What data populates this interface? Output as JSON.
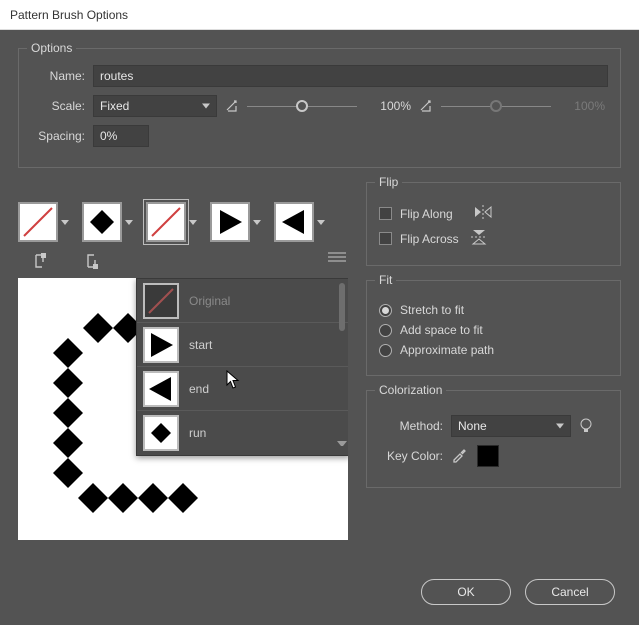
{
  "window": {
    "title": "Pattern Brush Options"
  },
  "options": {
    "title": "Options",
    "name_label": "Name:",
    "name_value": "routes",
    "scale_label": "Scale:",
    "scale_mode": "Fixed",
    "scale_value": "100%",
    "scale_value2": "100%",
    "spacing_label": "Spacing:",
    "spacing_value": "0%"
  },
  "tiles": {
    "slots": [
      "outer-corner",
      "side",
      "inner-corner",
      "start",
      "end"
    ],
    "dropdown_items": [
      {
        "key": "original",
        "label": "Original",
        "dim": true
      },
      {
        "key": "start",
        "label": "start"
      },
      {
        "key": "end",
        "label": "end"
      },
      {
        "key": "run",
        "label": "run"
      }
    ]
  },
  "flip": {
    "title": "Flip",
    "along_label": "Flip Along",
    "across_label": "Flip Across",
    "along_checked": false,
    "across_checked": false
  },
  "fit": {
    "title": "Fit",
    "options": [
      {
        "key": "stretch",
        "label": "Stretch to fit",
        "selected": true
      },
      {
        "key": "addspace",
        "label": "Add space to fit",
        "selected": false
      },
      {
        "key": "approximate",
        "label": "Approximate path",
        "selected": false
      }
    ]
  },
  "colorization": {
    "title": "Colorization",
    "method_label": "Method:",
    "method_value": "None",
    "key_label": "Key Color:",
    "key_hex": "#000000"
  },
  "buttons": {
    "ok": "OK",
    "cancel": "Cancel"
  }
}
